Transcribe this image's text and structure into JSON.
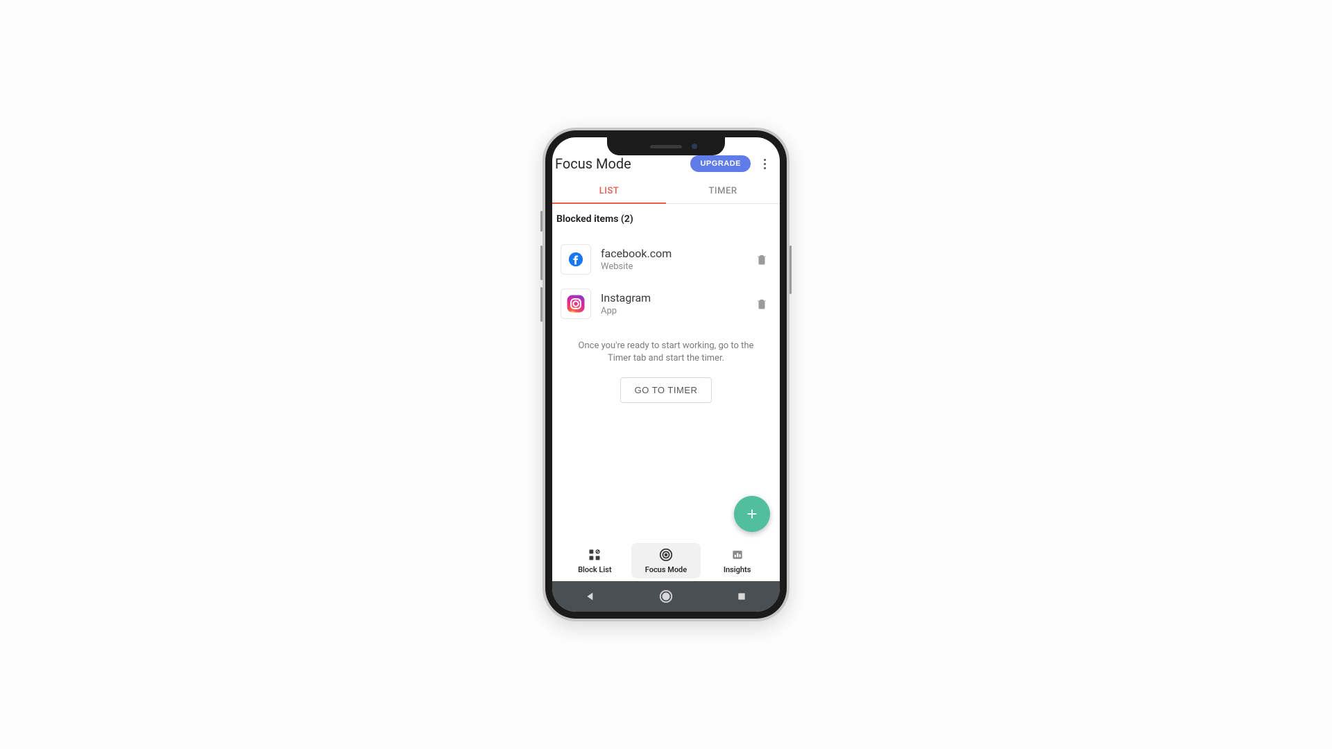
{
  "header": {
    "title": "Focus Mode",
    "upgrade_label": "UPGRADE"
  },
  "tabs": {
    "list_label": "LIST",
    "timer_label": "TIMER",
    "active": "list"
  },
  "section": {
    "title": "Blocked items (2)"
  },
  "items": [
    {
      "title": "facebook.com",
      "subtitle": "Website",
      "icon": "facebook"
    },
    {
      "title": "Instagram",
      "subtitle": "App",
      "icon": "instagram"
    }
  ],
  "hint": "Once you're ready to start working, go to the Timer tab and start the timer.",
  "secondary_button": "GO TO TIMER",
  "fab_label": "+",
  "bottom_nav": {
    "blocklist_label": "Block List",
    "focusmode_label": "Focus Mode",
    "insights_label": "Insights",
    "active": "focusmode"
  }
}
